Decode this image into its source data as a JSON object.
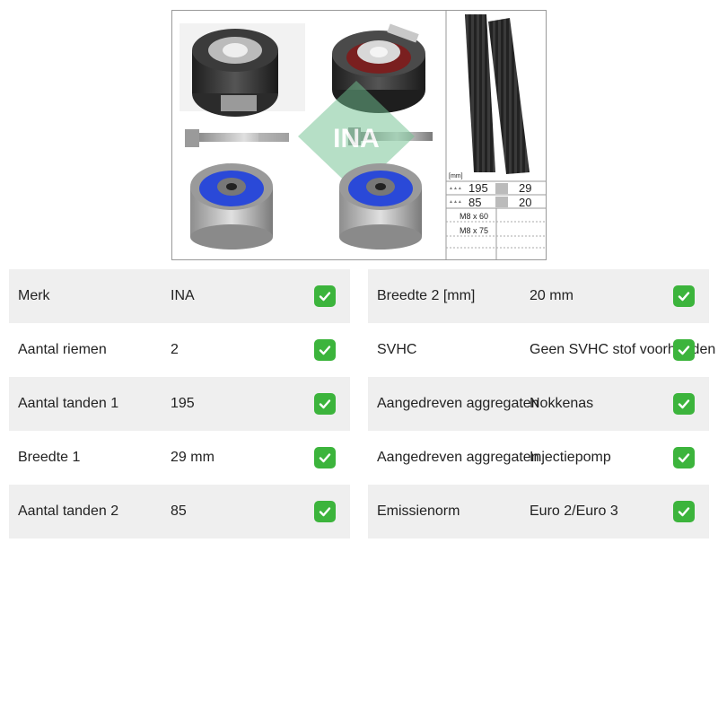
{
  "product_image": {
    "brand_watermark": "INA",
    "unit_label": "[mm]",
    "specs": [
      {
        "teeth": "195",
        "width": "29"
      },
      {
        "teeth": "85",
        "width": "20"
      }
    ],
    "bolts": [
      "M8 x 60",
      "M8 x 75"
    ]
  },
  "specs_left": [
    {
      "label": "Merk",
      "value": "INA"
    },
    {
      "label": "Aantal riemen",
      "value": "2"
    },
    {
      "label": "Aantal tanden 1",
      "value": "195"
    },
    {
      "label": "Breedte 1",
      "value": "29 mm"
    },
    {
      "label": "Aantal tanden 2",
      "value": "85"
    }
  ],
  "specs_right": [
    {
      "label": "Breedte 2 [mm]",
      "value": "20 mm"
    },
    {
      "label": "SVHC",
      "value": "Geen SVHC stof voorhanden"
    },
    {
      "label": "Aangedreven aggregaten",
      "value": "Nokkenas"
    },
    {
      "label": "Aangedreven aggregaten",
      "value": "Injectiepomp"
    },
    {
      "label": "Emissienorm",
      "value": "Euro 2/Euro 3"
    }
  ],
  "colors": {
    "row_shade": "#efefef",
    "check_green": "#3cb43c",
    "ina_green": "#2e8b57",
    "pulley_blue": "#2a49d8"
  }
}
